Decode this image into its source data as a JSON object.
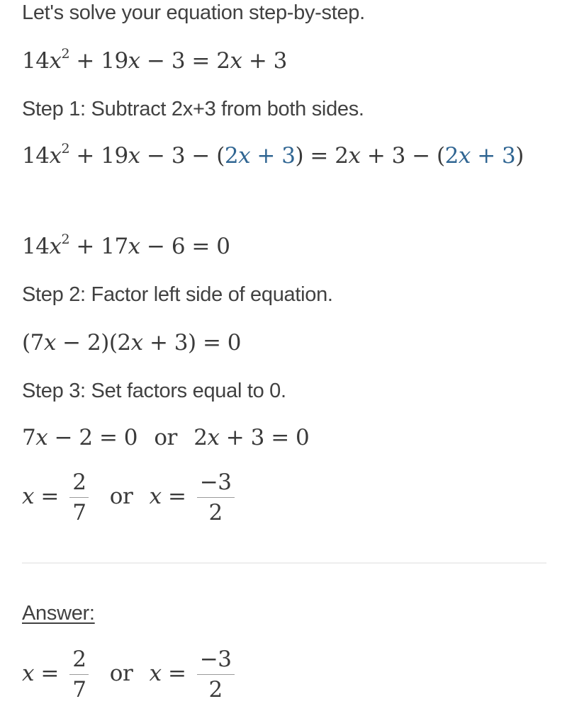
{
  "intro": "Let's solve your equation step-by-step.",
  "equation": {
    "lhs_coef": "14",
    "var": "x",
    "exp": "2",
    "rest_lhs": "+ 19",
    "rest_lhs2": "− 3 =",
    "rhs_coef": "2",
    "rhs_rest": "+ 3"
  },
  "steps": [
    {
      "label": "Step 1: Subtract 2x+3 from both sides."
    },
    {
      "label": "Step 2: Factor left side of equation."
    },
    {
      "label": "Step 3: Set factors equal to 0."
    }
  ],
  "step1": {
    "a": "14",
    "b": "+ 19",
    "c": "− 3 − (",
    "blue1": "2",
    "blue1b": " + 3",
    "d": ") = 2",
    "e": " + 3 − (",
    "blue2": "2",
    "blue2b": " + 3",
    "f": ")"
  },
  "simplified": {
    "a": "14",
    "b": "+ 17",
    "c": "− 6 = 0"
  },
  "factored": {
    "a": "(7",
    "b": " − 2)(2",
    "c": " + 3) = 0"
  },
  "factors_zero": {
    "a": "7",
    "b": " − 2 = 0",
    "or": "or",
    "c": "2",
    "d": " + 3 = 0"
  },
  "solutions": {
    "var": "x",
    "eq": " =",
    "frac1_num": "2",
    "frac1_den": "7",
    "or": "or",
    "frac2_num": "−3",
    "frac2_den": "2"
  },
  "answer": {
    "label": "Answer:"
  },
  "colors": {
    "highlight": "#2f6592",
    "text": "#414141"
  }
}
